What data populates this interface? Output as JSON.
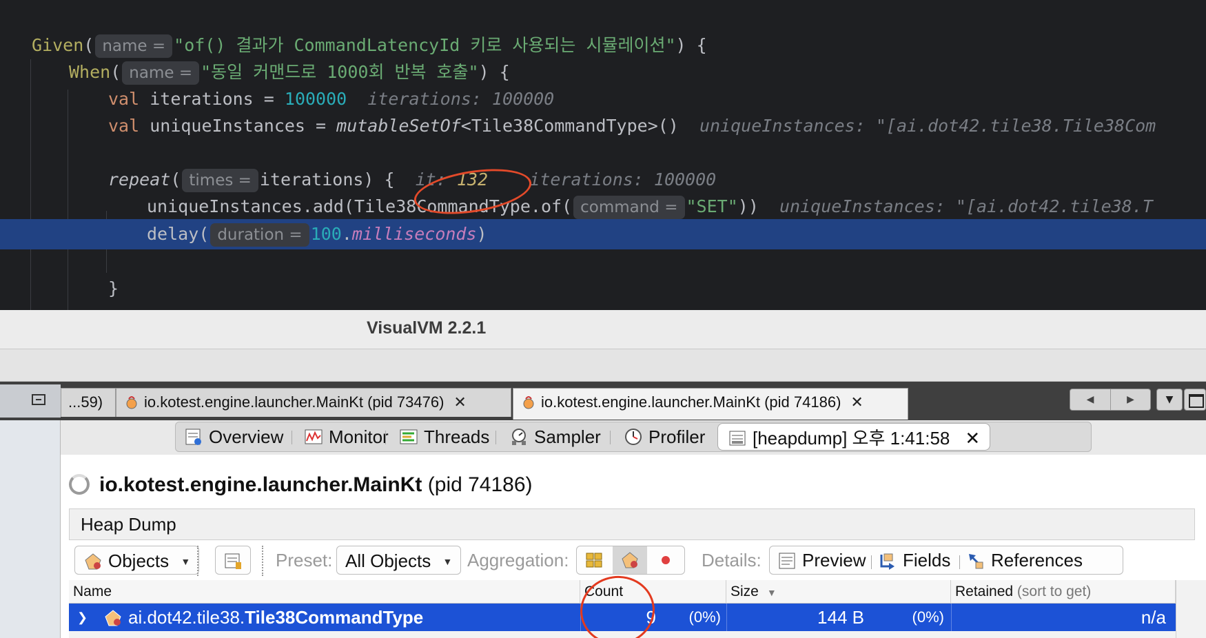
{
  "editor": {
    "lines": [
      {
        "fn": "Given",
        "param": "name =",
        "str": "\"of() 결과가 CommandLatencyId 키로 사용되는 시뮬레이션\"",
        "tail": ") {"
      },
      {
        "fn": "When",
        "param": "name =",
        "str": "\"동일 커맨드로 1000회 반복 호출\"",
        "tail": ") {"
      },
      {
        "kw": "val",
        "name": "iterations = ",
        "num": "100000",
        "debug": "iterations: 100000"
      },
      {
        "kw": "val",
        "name": "uniqueInstances = ",
        "call": "mutableSetOf",
        "generic": "<Tile38CommandType>()",
        "debug": "uniqueInstances: \"[ai.dot42.tile38.Tile38Com"
      },
      {
        "fn": "repeat",
        "param": "times =",
        "arg": "iterations) {",
        "debug_label": "it: ",
        "debug_value": "132",
        "debug2": "iterations: 100000"
      },
      {
        "prefix": "uniqueInstances.add(Tile38CommandType.of(",
        "param": "command =",
        "str": "\"SET\"",
        "tail": "))",
        "debug": "uniqueInstances: \"[ai.dot42.tile38.T"
      },
      {
        "fn": "delay(",
        "param": "duration =",
        "num": "100",
        "dot": ".",
        "ext": "milliseconds",
        "tail": ")"
      },
      {
        "brace": "}"
      }
    ]
  },
  "window": {
    "title": "VisualVM 2.2.1",
    "tabs": [
      {
        "label": "...59)"
      },
      {
        "label": "io.kotest.engine.launcher.MainKt (pid 73476)"
      },
      {
        "label": "io.kotest.engine.launcher.MainKt (pid 74186)"
      }
    ],
    "close_glyph": "✕",
    "nav": {
      "prev": "◀",
      "next": "▶",
      "menu": "▼"
    },
    "subtabs": [
      "Overview",
      "Monitor",
      "Threads",
      "Sampler",
      "Profiler",
      "[heapdump] 오후 1:41:58"
    ],
    "process": {
      "name": "io.kotest.engine.launcher.MainKt",
      "pid": "(pid 74186)"
    },
    "heap_dump_label": "Heap Dump",
    "controls": {
      "objects": "Objects",
      "preset_label": "Preset:",
      "preset_value": "All Objects",
      "aggregation_label": "Aggregation:",
      "details_label": "Details:",
      "preview": "Preview",
      "fields": "Fields",
      "references": "References"
    },
    "table": {
      "headers": {
        "name": "Name",
        "count": "Count",
        "size": "Size",
        "retained": "Retained",
        "retained_hint": "(sort to get)"
      },
      "rows": [
        {
          "expand": "❯",
          "package": "ai.dot42.tile38.",
          "class": "Tile38CommandType",
          "count": "9",
          "count_pct": "(0%)",
          "size": "144 B",
          "size_pct": "(0%)",
          "retained": "n/a"
        }
      ]
    }
  },
  "colors": {
    "selection": "#1c52d6",
    "code_highlight": "#214283",
    "annotation": "#e34a2a"
  }
}
